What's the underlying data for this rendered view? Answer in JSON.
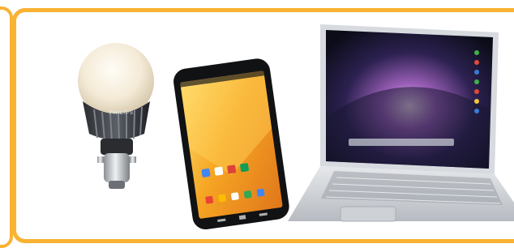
{
  "frame": {
    "accent_color": "#f9b233"
  },
  "devices": [
    {
      "name": "light-bulb",
      "brand_label": "PHILIPS"
    },
    {
      "name": "smartphone"
    },
    {
      "name": "laptop"
    }
  ]
}
